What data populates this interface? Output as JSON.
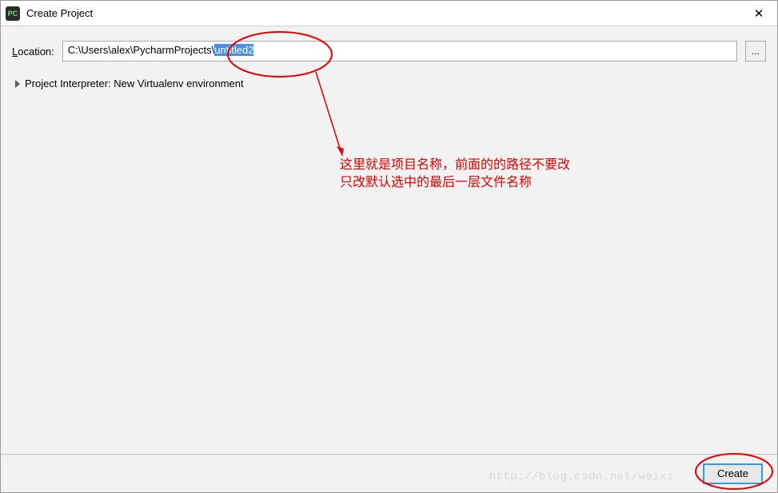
{
  "title": "Create Project",
  "app_icon_text": "PC",
  "close_symbol": "✕",
  "location": {
    "label_prefix": "L",
    "label_rest": "ocation:",
    "path_prefix": "C:\\Users\\alex\\PycharmProjects\\",
    "path_selected": "untitled2"
  },
  "browse_button": "...",
  "interpreter": {
    "label": "Project Interpreter: New Virtualenv environment"
  },
  "create_button": "Create",
  "annotation": {
    "line1": "这里就是项目名称，前面的的路径不要改",
    "line2": "只改默认选中的最后一层文件名称"
  },
  "watermark": "http://blog.csdn.net/weixi"
}
